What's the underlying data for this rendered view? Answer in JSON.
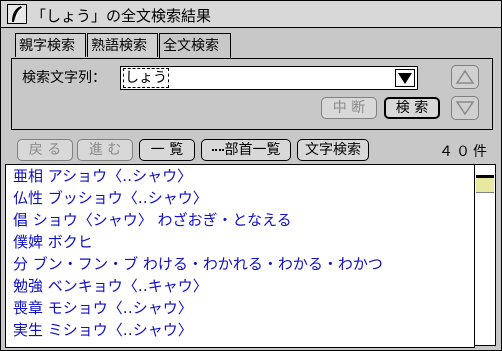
{
  "window": {
    "title": "「しょう」の全文検索結果",
    "icon": "quill-icon"
  },
  "tabs": [
    {
      "label": "親字検索",
      "active": false
    },
    {
      "label": "熟語検索",
      "active": false
    },
    {
      "label": "全文検索",
      "active": true
    }
  ],
  "search": {
    "label": "検索文字列：",
    "value": "しょう",
    "interrupt_label": "中 断",
    "search_label": "検 索"
  },
  "toolbar": {
    "back_label": "戻 る",
    "forward_label": "進 む",
    "list_label": "一 覧",
    "radical_label": "部首一覧",
    "char_search_label": "文字検索",
    "count": "４０件"
  },
  "results": [
    "亜相 アショウ〈‥シャウ〉",
    "仏性 ブッショウ〈‥シャウ〉",
    "倡 ショウ〈シャウ〉 わざおぎ・となえる",
    "僕婢 ボクヒ",
    "分 ブン・フン・ブ わける・わかれる・わかる・わかつ",
    "勉強 ベンキョウ〈‥キャウ〉",
    "喪章 モショウ〈‥シャウ〉",
    "実生 ミショウ〈‥シャウ〉"
  ],
  "colors": {
    "result_text": "#1010c8",
    "window_bg": "#c8c8c8"
  }
}
